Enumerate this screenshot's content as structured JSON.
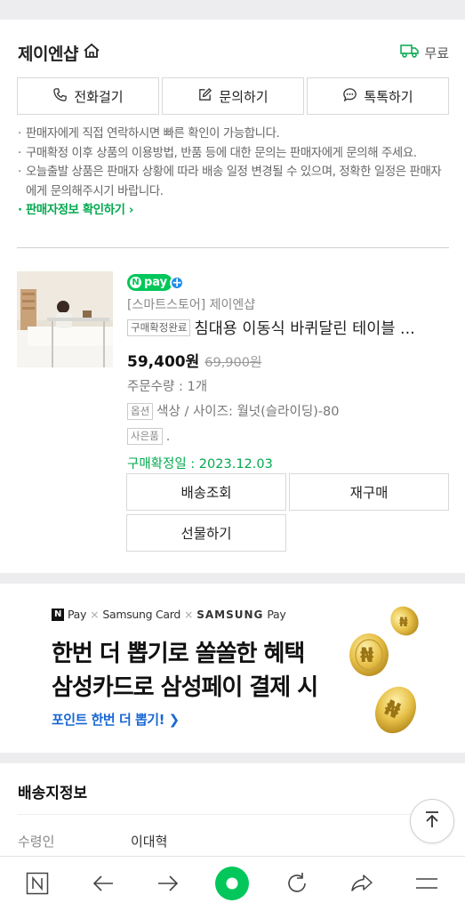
{
  "seller": {
    "name": "제이엔샵",
    "shipping_label": "무료",
    "contact_buttons": {
      "call": "전화걸기",
      "inquiry": "문의하기",
      "talk": "톡톡하기"
    },
    "notices": [
      "판매자에게 직접 연락하시면 빠른 확인이 가능합니다.",
      "구매확정 이후 상품의 이용방법, 반품 등에 대한 문의는 판매자에게 문의해 주세요.",
      "오늘출발 상품은 판매자 상황에 따라 배송 일정 변경될 수 있으며, 정확한 일정은 판매자에게 문의해주시기 바랍니다."
    ],
    "seller_info_link": "판매자정보 확인하기"
  },
  "product": {
    "npay_label": "pay",
    "store": "[스마트스토어] 제이엔샵",
    "status_badge": "구매확정완료",
    "title": "침대용 이동식 바퀴달린 테이블 ...",
    "price": "59,400원",
    "original_price": "69,900원",
    "quantity": "주문수량 : 1개",
    "option_badge": "옵션",
    "option": "색상 / 사이즈: 월넛(슬라이딩)-80",
    "gift_badge": "사은품",
    "gift": ".",
    "confirm_date": "구매확정일 : 2023.12.03"
  },
  "actions": {
    "track": "배송조회",
    "reorder": "재구매",
    "gift": "선물하기"
  },
  "banner": {
    "brand_npay": "Pay",
    "brand_card": "Samsung Card",
    "brand_samsung": "SAMSUNG",
    "brand_pay": "Pay",
    "title_line1": "한번 더 뽑기로 쏠쏠한 혜택",
    "title_line2": "삼성카드로 삼성페이 결제 시",
    "cta": "포인트 한번 더 뽑기!"
  },
  "shipping_info": {
    "title": "배송지정보",
    "recipient_label": "수령인",
    "recipient_value": "이대혁"
  },
  "colors": {
    "naver_green": "#03c75a",
    "link_green": "#03a94f",
    "cta_blue": "#1967d2"
  }
}
